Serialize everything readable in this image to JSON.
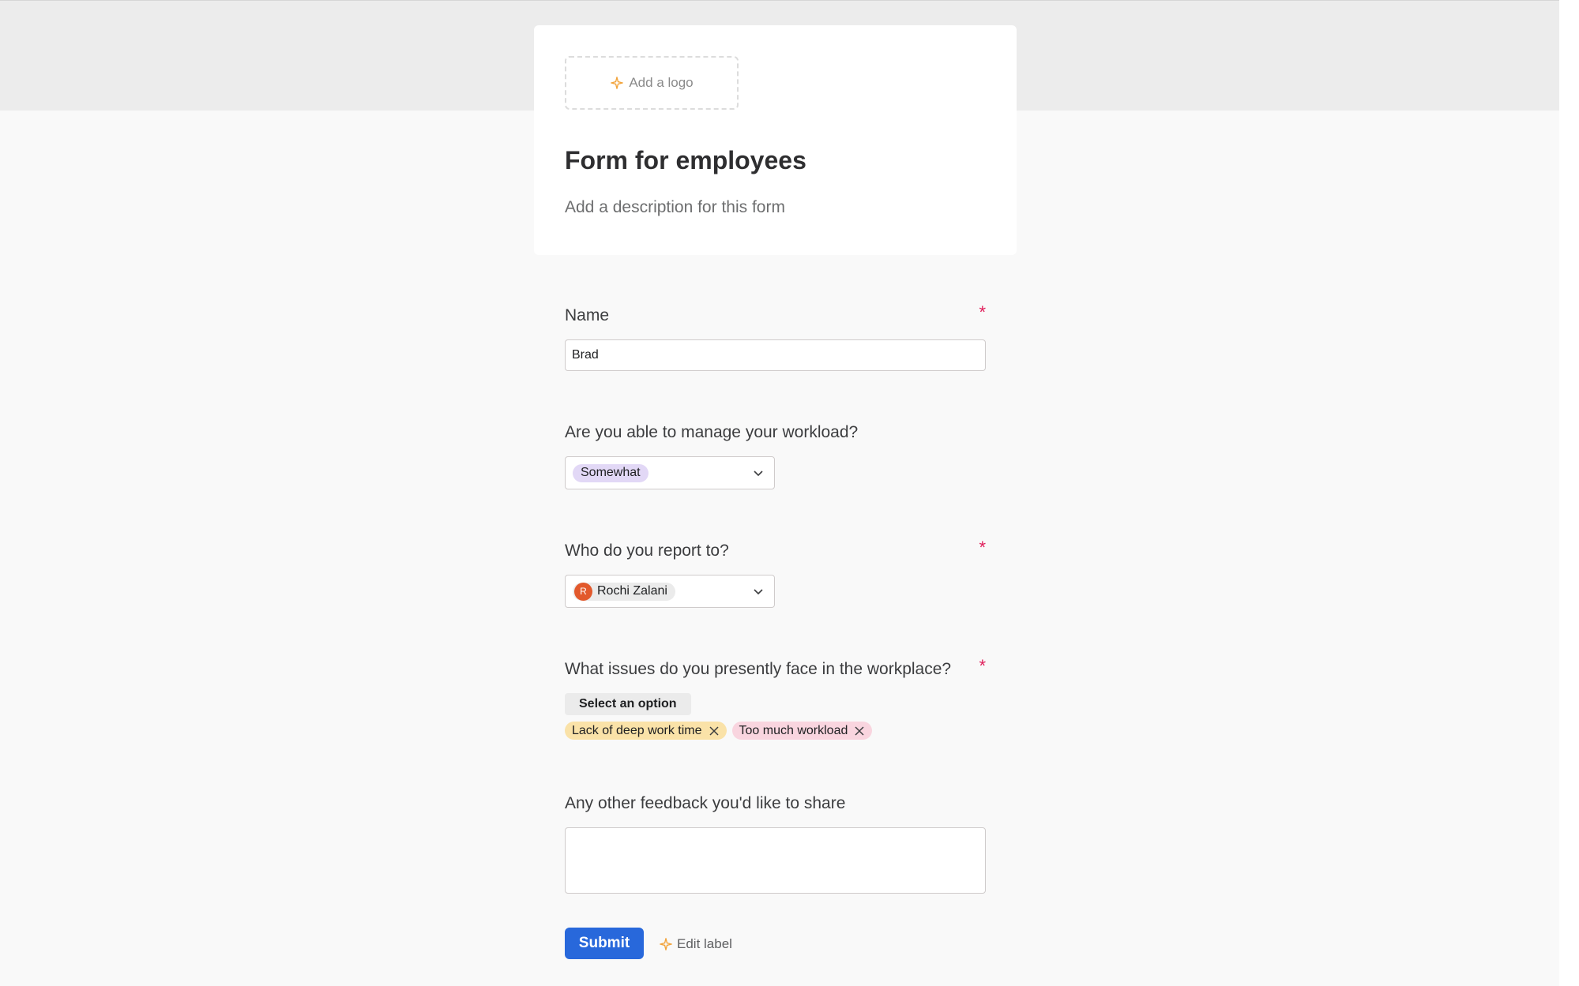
{
  "header": {
    "add_logo_label": "Add a logo",
    "title": "Form for employees",
    "description_placeholder": "Add a description for this form"
  },
  "questions": {
    "name": {
      "label": "Name",
      "required_mark": "*",
      "value": "Brad"
    },
    "workload": {
      "label": "Are you able to manage your workload?",
      "selected": "Somewhat"
    },
    "report_to": {
      "label": "Who do you report to?",
      "required_mark": "*",
      "avatar_initial": "R",
      "selected": "Rochi Zalani"
    },
    "issues": {
      "label": "What issues do you presently face in the workplace?",
      "required_mark": "*",
      "select_label": "Select an option",
      "tags": [
        "Lack of deep work time",
        "Too much workload"
      ]
    },
    "feedback": {
      "label": "Any other feedback you'd like to share",
      "value": ""
    }
  },
  "footer": {
    "submit_label": "Submit",
    "edit_label": "Edit label"
  },
  "colors": {
    "accent": "#2868db",
    "required": "#e01e5a",
    "avatar": "#e2592c",
    "tag_yellow": "#fae2a8",
    "tag_pink": "#f9d5df",
    "pill_lavender": "#e2d8f6"
  }
}
